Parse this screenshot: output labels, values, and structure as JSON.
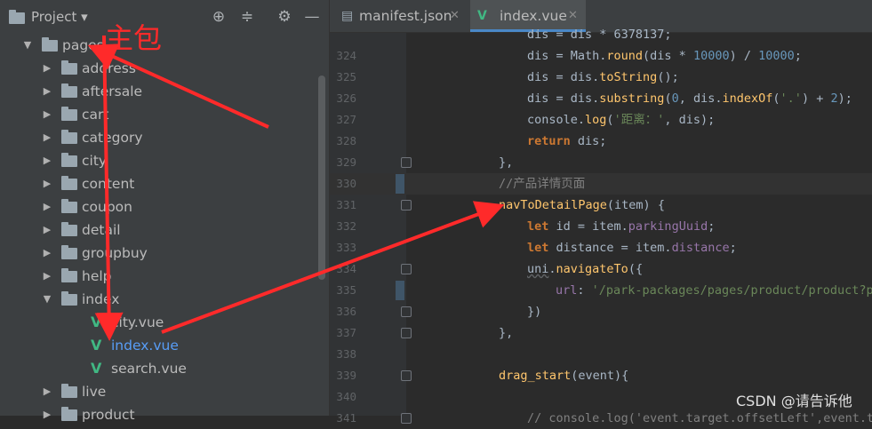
{
  "project": {
    "title": "Project",
    "tree": [
      {
        "label": "pages",
        "type": "folder",
        "expanded": true,
        "depth": 0
      },
      {
        "label": "address",
        "type": "folder",
        "expanded": false,
        "depth": 1
      },
      {
        "label": "aftersale",
        "type": "folder",
        "expanded": false,
        "depth": 1
      },
      {
        "label": "cart",
        "type": "folder",
        "expanded": false,
        "depth": 1
      },
      {
        "label": "category",
        "type": "folder",
        "expanded": false,
        "depth": 1
      },
      {
        "label": "city",
        "type": "folder",
        "expanded": false,
        "depth": 1
      },
      {
        "label": "content",
        "type": "folder",
        "expanded": false,
        "depth": 1
      },
      {
        "label": "coupon",
        "type": "folder",
        "expanded": false,
        "depth": 1
      },
      {
        "label": "detail",
        "type": "folder",
        "expanded": false,
        "depth": 1
      },
      {
        "label": "groupbuy",
        "type": "folder",
        "expanded": false,
        "depth": 1
      },
      {
        "label": "help",
        "type": "folder",
        "expanded": false,
        "depth": 1
      },
      {
        "label": "index",
        "type": "folder",
        "expanded": true,
        "depth": 1
      },
      {
        "label": "city.vue",
        "type": "vue",
        "depth": 2
      },
      {
        "label": "index.vue",
        "type": "vue",
        "depth": 2,
        "selected": true
      },
      {
        "label": "search.vue",
        "type": "vue",
        "depth": 2
      },
      {
        "label": "live",
        "type": "folder",
        "expanded": false,
        "depth": 1
      },
      {
        "label": "product",
        "type": "folder",
        "expanded": false,
        "depth": 1
      }
    ]
  },
  "tabs": [
    {
      "label": "manifest.json",
      "icon": "json-file-icon",
      "active": false
    },
    {
      "label": "index.vue",
      "icon": "vue-file-icon",
      "active": true
    }
  ],
  "code": {
    "lines": [
      {
        "n": "",
        "tokens": [
          [
            "plain",
            "dis = dis * 6378137;"
          ]
        ]
      },
      {
        "n": "324",
        "tokens": [
          [
            "plain",
            "dis = Math."
          ],
          [
            "fn",
            "round"
          ],
          [
            "plain",
            "(dis * "
          ],
          [
            "num-lit",
            "10000"
          ],
          [
            "plain",
            ") / "
          ],
          [
            "num-lit",
            "10000"
          ],
          [
            "plain",
            ";"
          ]
        ]
      },
      {
        "n": "325",
        "tokens": [
          [
            "plain",
            "dis = dis."
          ],
          [
            "fn",
            "toString"
          ],
          [
            "plain",
            "();"
          ]
        ]
      },
      {
        "n": "326",
        "tokens": [
          [
            "plain",
            "dis = dis."
          ],
          [
            "fn",
            "substring"
          ],
          [
            "plain",
            "("
          ],
          [
            "num-lit",
            "0"
          ],
          [
            "plain",
            ", dis."
          ],
          [
            "fn",
            "indexOf"
          ],
          [
            "plain",
            "("
          ],
          [
            "str",
            "'.'"
          ],
          [
            "plain",
            ") + "
          ],
          [
            "num-lit",
            "2"
          ],
          [
            "plain",
            ");"
          ]
        ]
      },
      {
        "n": "327",
        "tokens": [
          [
            "plain",
            "console."
          ],
          [
            "fn",
            "log"
          ],
          [
            "plain",
            "("
          ],
          [
            "str",
            "'距离：'"
          ],
          [
            "plain",
            ", dis);"
          ]
        ]
      },
      {
        "n": "328",
        "tokens": [
          [
            "kw",
            "return"
          ],
          [
            "plain",
            " dis;"
          ]
        ]
      },
      {
        "n": "329",
        "tokens": [
          [
            "plain",
            "},"
          ]
        ]
      },
      {
        "n": "330",
        "tokens": [
          [
            "cmt",
            "//产品详情页面"
          ]
        ]
      },
      {
        "n": "331",
        "tokens": [
          [
            "fn",
            "navToDetailPage"
          ],
          [
            "plain",
            "(item) {"
          ]
        ]
      },
      {
        "n": "332",
        "tokens": [
          [
            "kw",
            "let"
          ],
          [
            "plain",
            " id = item."
          ],
          [
            "prop",
            "parkingUuid"
          ],
          [
            "plain",
            ";"
          ]
        ]
      },
      {
        "n": "333",
        "tokens": [
          [
            "kw",
            "let"
          ],
          [
            "plain",
            " distance = item."
          ],
          [
            "prop",
            "distance"
          ],
          [
            "plain",
            ";"
          ]
        ]
      },
      {
        "n": "334",
        "tokens": [
          [
            "under",
            "uni"
          ],
          [
            "plain",
            "."
          ],
          [
            "fn",
            "navigateTo"
          ],
          [
            "plain",
            "({"
          ]
        ]
      },
      {
        "n": "335",
        "tokens": [
          [
            "prop",
            "url"
          ],
          [
            "plain",
            ": "
          ],
          [
            "str",
            "'/park-packages/pages/product/product?park"
          ]
        ]
      },
      {
        "n": "336",
        "tokens": [
          [
            "plain",
            "})"
          ]
        ]
      },
      {
        "n": "337",
        "tokens": [
          [
            "plain",
            "},"
          ]
        ]
      },
      {
        "n": "338",
        "tokens": []
      },
      {
        "n": "339",
        "tokens": [
          [
            "fn",
            "drag_start"
          ],
          [
            "plain",
            "(event){"
          ]
        ]
      },
      {
        "n": "340",
        "tokens": []
      },
      {
        "n": "341",
        "tokens": [
          [
            "cmt",
            "// console.log('event.target.offsetLeft',event.ta"
          ]
        ]
      }
    ]
  },
  "annotation": {
    "label": "主包",
    "color": "#ff2a2a"
  },
  "watermark": "CSDN @请告诉他",
  "colors": {
    "keyword": "#cc7832",
    "function": "#ffc66d",
    "string": "#6a8759",
    "number": "#6897bb",
    "comment": "#808080",
    "property": "#9876aa",
    "vue": "#41b883",
    "selected": "#589df6"
  }
}
